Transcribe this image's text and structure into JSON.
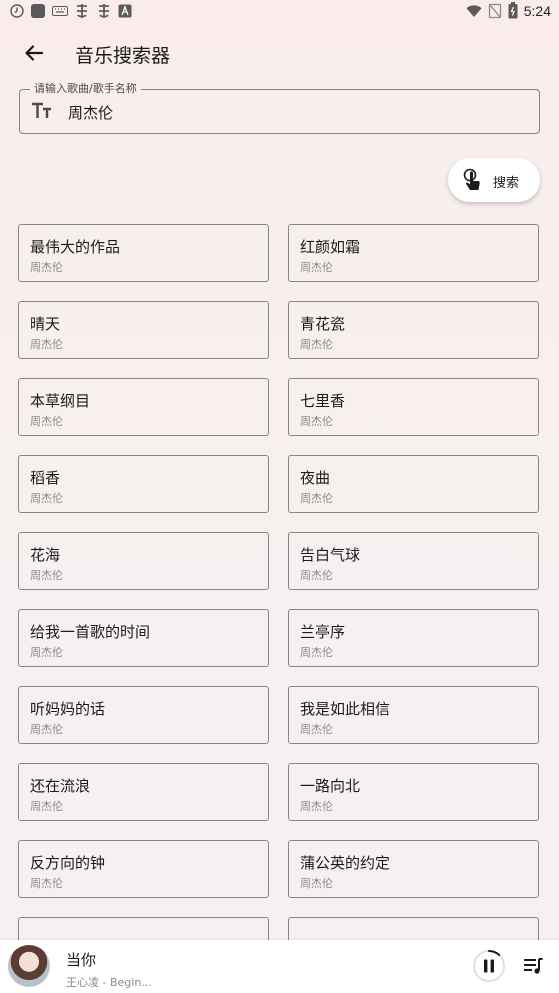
{
  "status_bar": {
    "time": "5:24",
    "left_icons": [
      "clock-icon",
      "square-app-icon",
      "keyboard-icon",
      "bug-icon",
      "bug-icon",
      "font-a-icon"
    ],
    "right_icons": [
      "wifi-icon",
      "no-signal-icon",
      "battery-icon"
    ]
  },
  "app_bar": {
    "title": "音乐搜索器",
    "back_icon": "arrow-back-icon"
  },
  "search": {
    "label": "请输入歌曲/歌手名称",
    "value": "周杰伦",
    "icon": "text-size-icon",
    "button_label": "搜索",
    "button_icon": "tap-icon"
  },
  "results": [
    {
      "title": "最伟大的作品",
      "artist": "周杰伦"
    },
    {
      "title": "红颜如霜",
      "artist": "周杰伦"
    },
    {
      "title": "晴天",
      "artist": "周杰伦"
    },
    {
      "title": "青花瓷",
      "artist": "周杰伦"
    },
    {
      "title": "本草纲目",
      "artist": "周杰伦"
    },
    {
      "title": "七里香",
      "artist": "周杰伦"
    },
    {
      "title": "稻香",
      "artist": "周杰伦"
    },
    {
      "title": "夜曲",
      "artist": "周杰伦"
    },
    {
      "title": "花海",
      "artist": "周杰伦"
    },
    {
      "title": "告白气球",
      "artist": "周杰伦"
    },
    {
      "title": "给我一首歌的时间",
      "artist": "周杰伦"
    },
    {
      "title": "兰亭序",
      "artist": "周杰伦"
    },
    {
      "title": "听妈妈的话",
      "artist": "周杰伦"
    },
    {
      "title": "我是如此相信",
      "artist": "周杰伦"
    },
    {
      "title": "还在流浪",
      "artist": "周杰伦"
    },
    {
      "title": "一路向北",
      "artist": "周杰伦"
    },
    {
      "title": "反方向的钟",
      "artist": "周杰伦"
    },
    {
      "title": "蒲公英的约定",
      "artist": "周杰伦"
    },
    {
      "title": "",
      "artist": ""
    },
    {
      "title": "",
      "artist": ""
    }
  ],
  "now_playing": {
    "title": "当你",
    "subtitle": "王心凌 - Begin...",
    "play_state": "playing",
    "progress": 0.12,
    "pause_icon": "pause-icon",
    "queue_icon": "queue-music-icon"
  },
  "colors": {
    "background_top": "#fbecec",
    "background": "#f6f1f1",
    "card_border": "#8b8587",
    "secondary_text": "#8a8a8a"
  }
}
